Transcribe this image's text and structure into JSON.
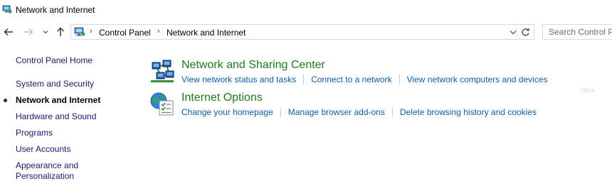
{
  "window": {
    "title": "Network and Internet"
  },
  "navigation": {
    "back_icon": "arrow-left",
    "forward_icon": "arrow-right",
    "recent_icon": "chevron-down",
    "up_icon": "arrow-up"
  },
  "address_bar": {
    "crumbs": [
      "Control Panel",
      "Network and Internet"
    ],
    "dropdown_icon": "chevron-down",
    "refresh_icon": "refresh"
  },
  "search": {
    "placeholder": "Search Control P"
  },
  "sidebar": {
    "items": [
      {
        "label": "Control Panel Home",
        "current": false
      },
      {
        "label": "System and Security",
        "current": false
      },
      {
        "label": "Network and Internet",
        "current": true
      },
      {
        "label": "Hardware and Sound",
        "current": false
      },
      {
        "label": "Programs",
        "current": false
      },
      {
        "label": "User Accounts",
        "current": false
      },
      {
        "label": "Appearance and",
        "current": false
      },
      {
        "label": "Personalization",
        "current": false
      }
    ]
  },
  "categories": [
    {
      "title": "Network and Sharing Center",
      "icon": "network-icon",
      "links": [
        "View network status and tasks",
        "Connect to a network",
        "View network computers and devices"
      ]
    },
    {
      "title": "Internet Options",
      "icon": "internet-options-icon",
      "links": [
        "Change your homepage",
        "Manage browser add-ons",
        "Delete browsing history and cookies"
      ]
    }
  ],
  "watermark": "VMon",
  "colors": {
    "category_title": "#1e7a1e",
    "link": "#0b5fb0",
    "sidebar_link": "#1a1a6b"
  }
}
